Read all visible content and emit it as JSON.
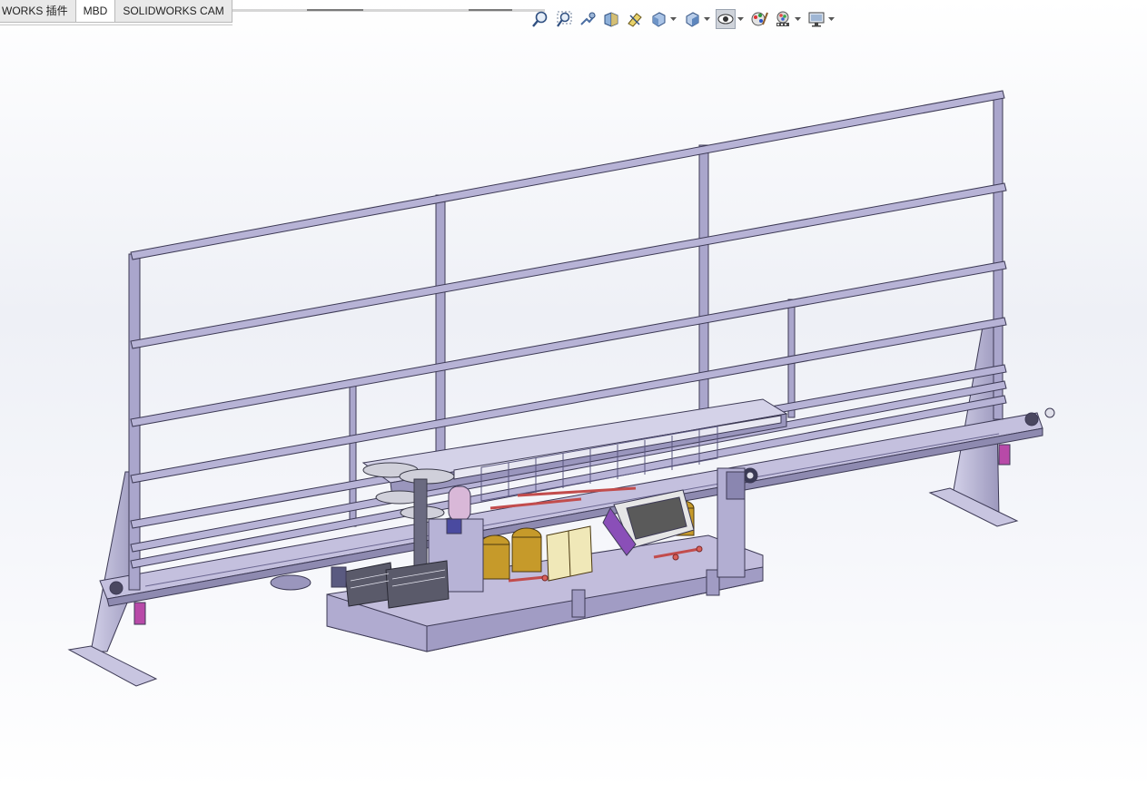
{
  "tabs": [
    {
      "label": "WORKS 插件",
      "active": false
    },
    {
      "label": "MBD",
      "active": true
    },
    {
      "label": "SOLIDWORKS CAM",
      "active": false
    }
  ],
  "toolbar": {
    "icons": [
      "zoom-to-fit-icon",
      "zoom-to-area-icon",
      "previous-view-icon",
      "section-view-icon",
      "dynamic-annotation-views-icon",
      "view-orientation-icon",
      "display-style-icon",
      "hide-show-items-icon",
      "edit-appearance-icon",
      "apply-scene-icon",
      "view-settings-icon"
    ]
  },
  "colors": {
    "frame": "#b7b3d6",
    "frame_edge": "#3d3a55",
    "base": "#c0bcd9",
    "accent_purple": "#a35db5",
    "accent_gold": "#c69a2a",
    "accent_red": "#d9605a"
  }
}
